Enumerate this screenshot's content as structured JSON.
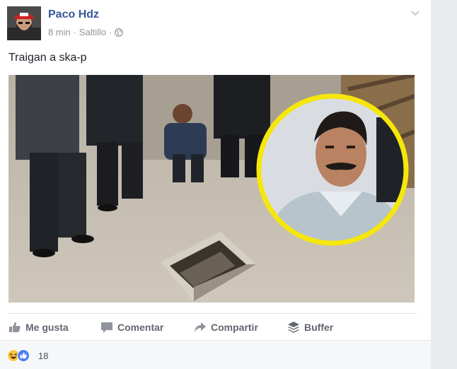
{
  "post": {
    "author": "Paco Hdz",
    "time": "8 min",
    "location": "Saltillo",
    "separator": "·",
    "text": "Traigan a ska-p"
  },
  "actions": {
    "like_label": "Me gusta",
    "comment_label": "Comentar",
    "share_label": "Compartir",
    "buffer_label": "Buffer"
  },
  "reactions": {
    "count": "18",
    "icons": [
      "haha-icon",
      "like-icon"
    ]
  },
  "colors": {
    "author_link": "#365899",
    "meta_text": "#90949c",
    "action_text": "#616770",
    "highlight_circle": "#f5e60c"
  }
}
